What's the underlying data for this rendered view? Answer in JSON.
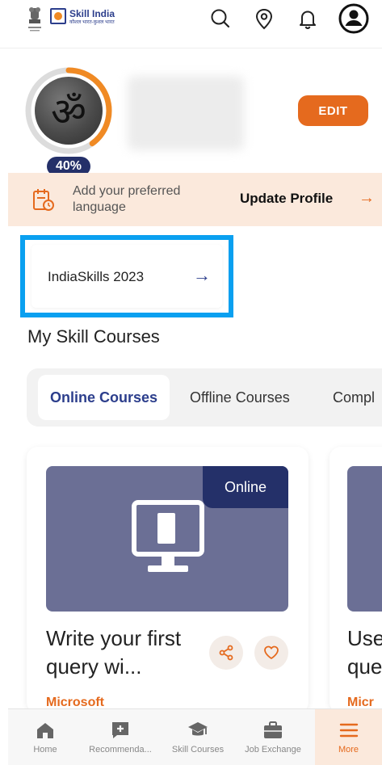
{
  "header": {
    "logo_title": "Skill India",
    "logo_subtitle": "कौशल भारत-कुशल भारत",
    "icons": [
      "search-icon",
      "location-icon",
      "bell-icon",
      "account-icon"
    ]
  },
  "profile": {
    "completion": "40%",
    "completion_fraction": 0.4,
    "edit_label": "EDIT"
  },
  "language_banner": {
    "text": "Add your preferred language",
    "link": "Update Profile",
    "arrow": "→"
  },
  "highlight": {
    "label": "IndiaSkills 2023",
    "arrow": "→"
  },
  "courses": {
    "section_title": "My Skill Courses",
    "tabs": [
      {
        "label": "Online Courses",
        "active": true
      },
      {
        "label": "Offline Courses",
        "active": false
      },
      {
        "label": "Compl",
        "active": false
      }
    ],
    "cards": [
      {
        "badge": "Online",
        "title": "Write your first query wi...",
        "provider": "Microsoft"
      },
      {
        "title_line1": "Use",
        "title_line2": "que",
        "provider": "Micr"
      }
    ]
  },
  "bottom_nav": {
    "items": [
      {
        "label": "Home"
      },
      {
        "label": "Recommenda..."
      },
      {
        "label": "Skill Courses"
      },
      {
        "label": "Job Exchange"
      },
      {
        "label": "More"
      }
    ]
  },
  "colors": {
    "accent": "#e56a1e",
    "brand": "#243069",
    "highlight_border": "#0aa0f0",
    "banner_bg": "#fbe9dc"
  }
}
